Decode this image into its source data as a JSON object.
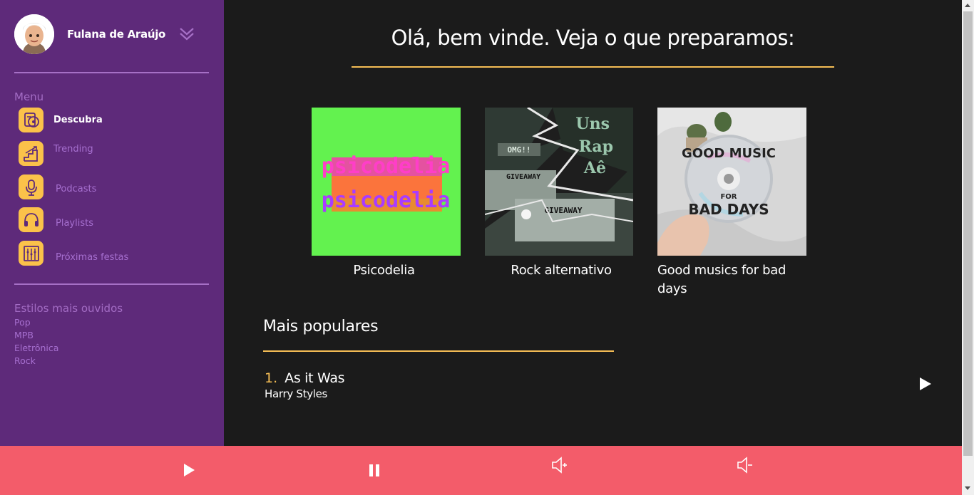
{
  "user": {
    "name": "Fulana de Araújo"
  },
  "menu": {
    "title": "Menu",
    "items": [
      {
        "label": "Descubra",
        "icon": "discover-icon",
        "active": true
      },
      {
        "label": "Trending",
        "icon": "trending-stairs-icon"
      },
      {
        "label": "Podcasts",
        "icon": "microphone-icon"
      },
      {
        "label": "Playlists",
        "icon": "headphones-icon"
      },
      {
        "label": "Próximas festas",
        "icon": "party-speaker-icon"
      }
    ]
  },
  "styles": {
    "title": "Estilos mais ouvidos",
    "items": [
      "Pop",
      "MPB",
      "Eletrônica",
      "Rock"
    ]
  },
  "main": {
    "title": "Olá, bem vinde. Veja o que preparamos:",
    "cards": [
      {
        "label": "Psicodelia",
        "cover_text": "psicodelia"
      },
      {
        "label": "Rock alternativo",
        "cover_text": "Uns Rap Aê"
      },
      {
        "label": "Good musics for bad days",
        "cover_text": "GOOD MUSIC FOR BAD DAYS"
      }
    ],
    "popular_title": "Mais populares",
    "tracks": [
      {
        "number": "1.",
        "title": "As it Was",
        "artist": "Harry Styles"
      }
    ]
  },
  "player": {
    "controls": [
      "play-icon",
      "pause-icon",
      "volume-up-icon",
      "volume-down-icon"
    ]
  },
  "colors": {
    "sidebar": "#5e2a7a",
    "accent_gold": "#f5bd55",
    "player_bar": "#f35c6a",
    "background": "#1b1b1b",
    "menu_icon_bg": "#fbc24a"
  }
}
